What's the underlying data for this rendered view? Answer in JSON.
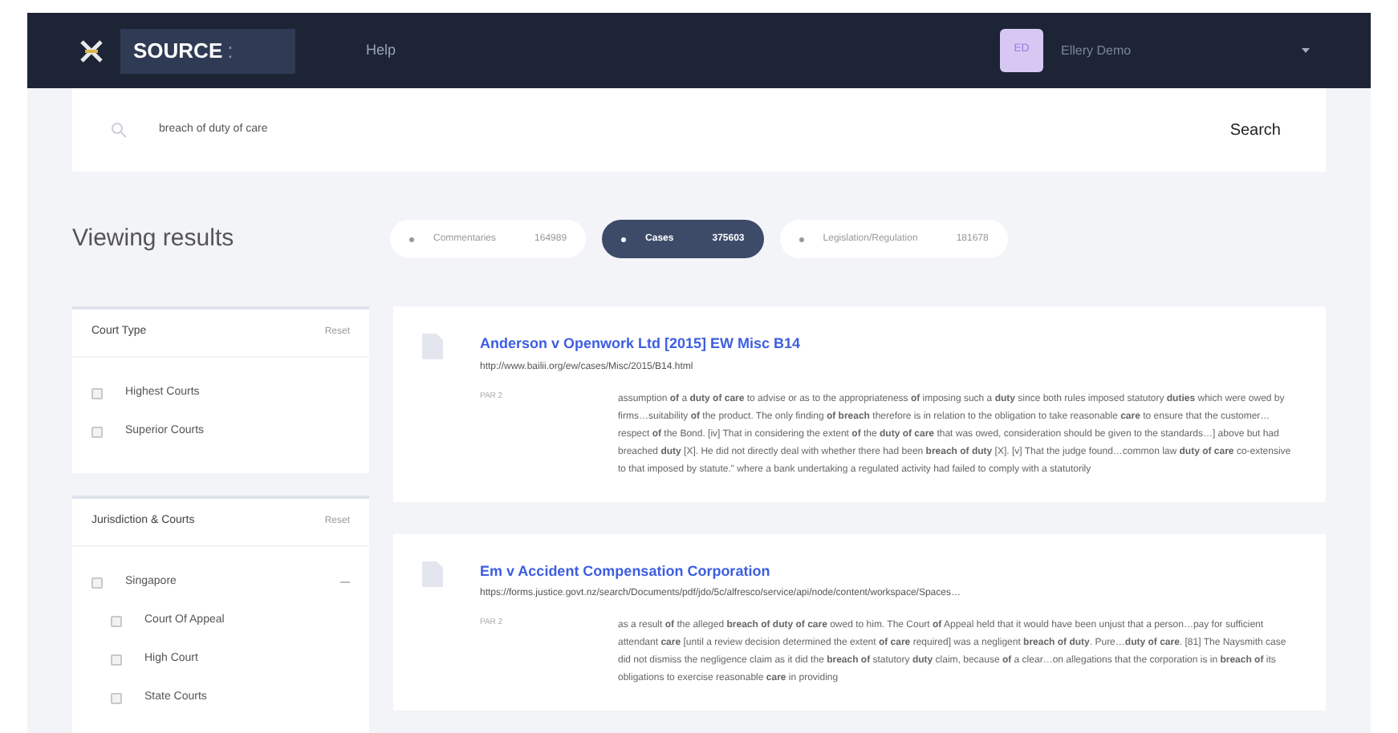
{
  "nav": {
    "logo": "SOURCE",
    "logo_suffix": ":",
    "links": [
      "Help"
    ],
    "user": {
      "initials": "ED",
      "name": "Ellery Demo"
    }
  },
  "search": {
    "value": "breach of duty of care",
    "button": "Search"
  },
  "heading": "Viewing results",
  "chips": [
    {
      "label": "Commentaries",
      "count": "164989",
      "selected": false
    },
    {
      "label": "Cases",
      "count": "375603",
      "selected": true
    },
    {
      "label": "Legislation/Regulation",
      "count": "181678",
      "selected": false
    }
  ],
  "filters": [
    {
      "title": "Court Type",
      "reset": "Reset",
      "items": [
        {
          "label": "Highest Courts",
          "checked": false
        },
        {
          "label": "Superior Courts",
          "checked": false
        }
      ]
    },
    {
      "title": "Jurisdiction & Courts",
      "reset": "Reset",
      "items": [
        {
          "label": "Singapore",
          "checked": false,
          "expanded": true,
          "children": [
            {
              "label": "Court Of Appeal",
              "checked": false
            },
            {
              "label": "High Court",
              "checked": false
            },
            {
              "label": "State Courts",
              "checked": false
            }
          ]
        }
      ]
    }
  ],
  "results": [
    {
      "title": "Anderson v Openwork Ltd [2015] EW Misc B14",
      "url": "http://www.bailii.org/ew/cases/Misc/2015/B14.html",
      "para": "PAR 2",
      "snippet": "assumption **of** a **duty of care** to advise or as to the appropriateness **of** imposing such a **duty** since both rules imposed statutory **duties** which were owed by firms…suitability **of** the product. The only finding **of breach** therefore is in relation to the obligation to take reasonable **care** to ensure that the customer…respect **of** the Bond. [iv] That in considering the extent **of** the **duty of care** that was owed, consideration should be given to the standards…] above but had breached **duty** [X]. He did not directly deal with whether there had been **breach of duty** [X]. [v] That the judge found…common law **duty of care** co-extensive to that imposed by statute.\" where a bank undertaking a regulated activity had failed to comply with a statutorily"
    },
    {
      "title": "Em v Accident Compensation Corporation",
      "url": "https://forms.justice.govt.nz/search/Documents/pdf/jdo/5c/alfresco/service/api/node/content/workspace/Spaces…",
      "para": "PAR 2",
      "snippet": "as a result **of** the alleged **breach of duty of care** owed to him. The Court **of** Appeal held that it would have been unjust that a person…pay for sufficient attendant **care** [until a review decision determined the extent **of care** required] was a negligent **breach of duty**. Pure…**duty of care**. [81] The Naysmith case did not dismiss the negligence claim as it did the **breach of** statutory **duty** claim, because **of** a clear…on allegations that the corporation is in **breach of** its obligations to exercise reasonable **care** in providing"
    }
  ]
}
